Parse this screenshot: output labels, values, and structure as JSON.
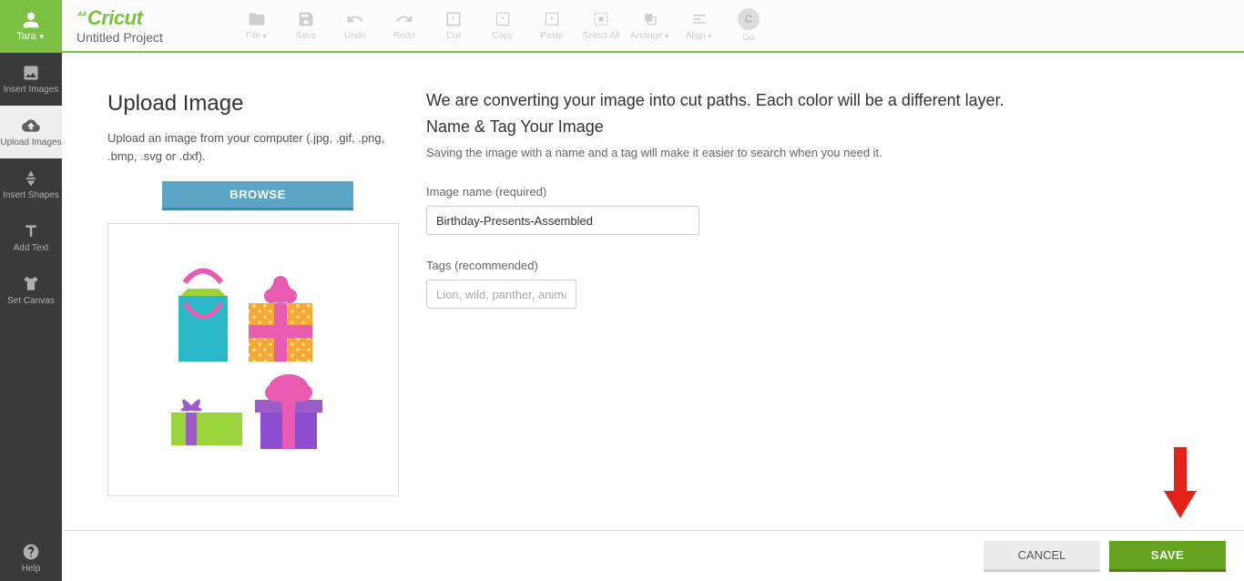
{
  "user": {
    "name": "Tara"
  },
  "brand": "Cricut",
  "project_title": "Untitled Project",
  "sidebar": {
    "items": [
      {
        "label": "Insert Images"
      },
      {
        "label": "Upload Images"
      },
      {
        "label": "Insert Shapes"
      },
      {
        "label": "Add Text"
      },
      {
        "label": "Set Canvas"
      }
    ],
    "help": "Help"
  },
  "toolbar": {
    "file": "File",
    "save": "Save",
    "undo": "Undo",
    "redo": "Redo",
    "cut": "Cut",
    "copy": "Copy",
    "paste": "Paste",
    "select_all": "Select All",
    "arrange": "Arrange",
    "align": "Align",
    "go": "Go",
    "go_letter": "C"
  },
  "upload": {
    "heading": "Upload Image",
    "desc": "Upload an image from your computer (.jpg, .gif, .png, .bmp, .svg or .dxf).",
    "browse": "BROWSE"
  },
  "form": {
    "line1": "We are converting your image into cut paths. Each color will be a different layer.",
    "line2": "Name & Tag Your Image",
    "hint": "Saving the image with a name and a tag will make it easier to search when you need it.",
    "name_label": "Image name (required)",
    "name_value": "Birthday-Presents-Assembled",
    "tags_label": "Tags (recommended)",
    "tags_placeholder": "Lion, wild, panther, animal"
  },
  "footer": {
    "cancel": "CANCEL",
    "save": "SAVE"
  }
}
